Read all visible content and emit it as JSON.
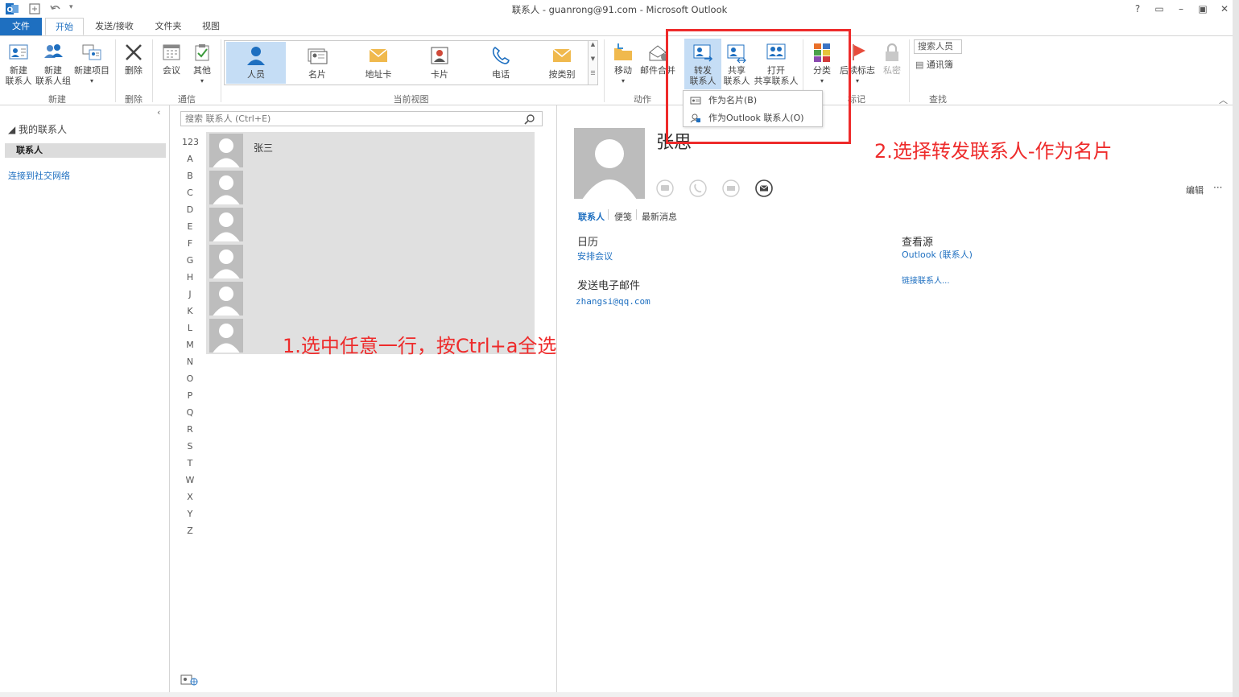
{
  "window": {
    "title": "联系人 - guanrong@91.com - Microsoft Outlook",
    "help": "?",
    "controls": [
      "▭",
      "–",
      "▣",
      "✕"
    ]
  },
  "tabs": [
    {
      "label": "文件"
    },
    {
      "label": "开始"
    },
    {
      "label": "发送/接收"
    },
    {
      "label": "文件夹"
    },
    {
      "label": "视图"
    }
  ],
  "ribbon": {
    "new_contact": "新建\n联系人",
    "new_group": "新建\n联系人组",
    "new_item": "新建项目",
    "group_new": "新建",
    "delete": "删除",
    "group_delete": "删除",
    "meeting": "会议",
    "more": "其他",
    "group_comm": "通信",
    "views": [
      "人员",
      "名片",
      "地址卡",
      "卡片",
      "电话",
      "按类别"
    ],
    "group_view": "当前视图",
    "move": "移动",
    "mail_merge": "邮件合并",
    "group_actions": "动作",
    "forward": "转发\n联系人",
    "share": "共享\n联系人",
    "open_shared": "打开\n共享联系人",
    "categorize": "分类",
    "followup": "后续标志",
    "private": "私密",
    "group_tags": "标记",
    "search_people": "搜索人员",
    "address_book": "通讯簿",
    "group_find": "查找"
  },
  "dropdown": {
    "item1": "作为名片(B)",
    "item2": "作为Outlook 联系人(O)"
  },
  "nav": {
    "header": "◢ 我的联系人",
    "folder": "联系人",
    "social": "连接到社交网络"
  },
  "list": {
    "search_placeholder": "搜索 联系人 (Ctrl+E)",
    "alphabet": [
      "123",
      "A",
      "B",
      "C",
      "D",
      "E",
      "F",
      "G",
      "H",
      "J",
      "K",
      "L",
      "M",
      "N",
      "O",
      "P",
      "Q",
      "R",
      "S",
      "T",
      "W",
      "X",
      "Y",
      "Z"
    ],
    "contacts": [
      {
        "name": "张三"
      },
      {
        "name": ""
      },
      {
        "name": ""
      },
      {
        "name": ""
      },
      {
        "name": ""
      },
      {
        "name": ""
      }
    ]
  },
  "reading": {
    "name": "张思",
    "edit": "编辑",
    "more": "···",
    "tabs": [
      "联系人",
      "便笺",
      "最新消息"
    ],
    "calendar": "日历",
    "schedule": "安排会议",
    "send_email": "发送电子邮件",
    "email": "zhangsi@qq.com",
    "view_source": "查看源",
    "source": "Outlook (联系人)",
    "link_contacts": "链接联系人..."
  },
  "annotations": {
    "step1": "1.选中任意一行，按Ctrl+a全选",
    "step2": "2.选择转发联系人-作为名片"
  },
  "colors": {
    "accent": "#1e6fc0",
    "annotation": "#ee2b2b",
    "selection": "#c5ddf5"
  }
}
